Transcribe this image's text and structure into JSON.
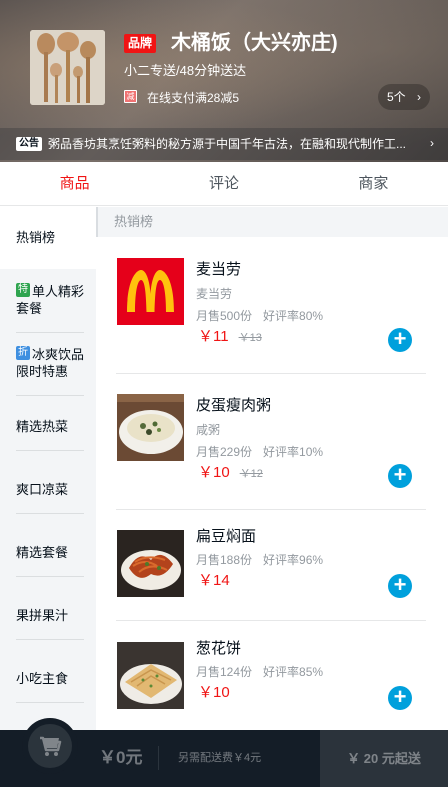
{
  "header": {
    "brand_badge": "品牌",
    "shop_name": "木桶饭（大兴亦庄)",
    "delivery_info": "小二专送/48分钟送达",
    "promo_badge": "减",
    "promo_text": "在线支付满28减5",
    "coupon_count": "5个",
    "bulletin_badge": "公告",
    "bulletin_text": "粥品香坊其烹饪粥料的秘方源于中国千年古法，在融和现代制作工..."
  },
  "tabs": [
    {
      "label": "商品"
    },
    {
      "label": "评论"
    },
    {
      "label": "商家"
    }
  ],
  "menu": {
    "items": [
      {
        "label": "热销榜"
      },
      {
        "label": "单人精彩套餐",
        "icon_text": "特",
        "icon_color": "#2ea44f"
      },
      {
        "label": "冰爽饮品限时特惠",
        "icon_text": "折",
        "icon_color": "#3e8fe0"
      },
      {
        "label": "精选热菜"
      },
      {
        "label": "爽口凉菜"
      },
      {
        "label": "精选套餐"
      },
      {
        "label": "果拼果汁"
      },
      {
        "label": "小吃主食"
      }
    ]
  },
  "foods": {
    "section_title": "热销榜",
    "items": [
      {
        "name": "麦当劳",
        "desc": "麦当劳",
        "sell": "月售500份",
        "rating": "好评率80%",
        "price": "￥11",
        "old_price": "￥13"
      },
      {
        "name": "皮蛋瘦肉粥",
        "desc": "咸粥",
        "sell": "月售229份",
        "rating": "好评率10%",
        "price": "￥10",
        "old_price": "￥12"
      },
      {
        "name": "扁豆焖面",
        "desc": "",
        "sell": "月售188份",
        "rating": "好评率96%",
        "price": "￥14",
        "old_price": ""
      },
      {
        "name": "葱花饼",
        "desc": "",
        "sell": "月售124份",
        "rating": "好评率85%",
        "price": "￥10",
        "old_price": ""
      }
    ]
  },
  "shopcart": {
    "total_price": "￥0元",
    "delivery_desc": "另需配送费￥4元",
    "pay_label": "￥ 20 元起送"
  },
  "icons": {
    "coupon_chevron": "chevron-right-icon",
    "bulletin_chevron": "chevron-right-icon",
    "add": "add-circle-icon",
    "cart": "shopping-cart-icon"
  }
}
